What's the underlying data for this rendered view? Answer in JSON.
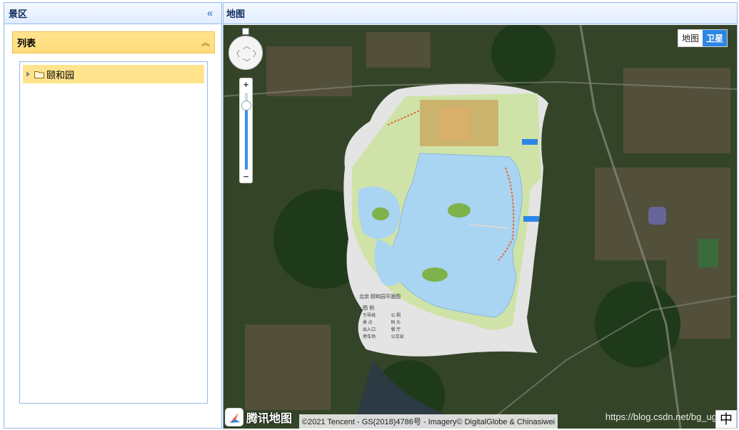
{
  "west": {
    "title": "景区",
    "collapse_icon": "double-chevron-left-icon",
    "accordion": {
      "title": "列表",
      "tool_icon": "double-chevron-up-icon",
      "tree": [
        {
          "label": "颐和园",
          "icon": "folder-icon",
          "expanded": false
        }
      ]
    }
  },
  "center": {
    "title": "地图",
    "map": {
      "map_types": [
        {
          "label": "地图",
          "active": false
        },
        {
          "label": "卫星",
          "active": true
        }
      ],
      "zoom": {
        "plus": "+",
        "minus": "−",
        "level_fraction": 0.83
      },
      "overlay_title": "北京 颐和园平面图",
      "legend_title": "图 例",
      "legend": [
        "引导线",
        "公 厕",
        "景 点",
        "码 头",
        "出入口",
        "餐 厅",
        "停车场",
        "公交站"
      ],
      "logo_text": "腾讯地图",
      "copyright": "©2021 Tencent - GS(2018)4786号 - Imagery© DigitalGlobe & Chinasiwei",
      "watermark": "https://blog.csdn.net/bg_ug",
      "ime": "中",
      "colors": {
        "lake": "#a9d4f2",
        "land": "#cfe3a8",
        "satellite": "#2c3b22"
      }
    }
  }
}
